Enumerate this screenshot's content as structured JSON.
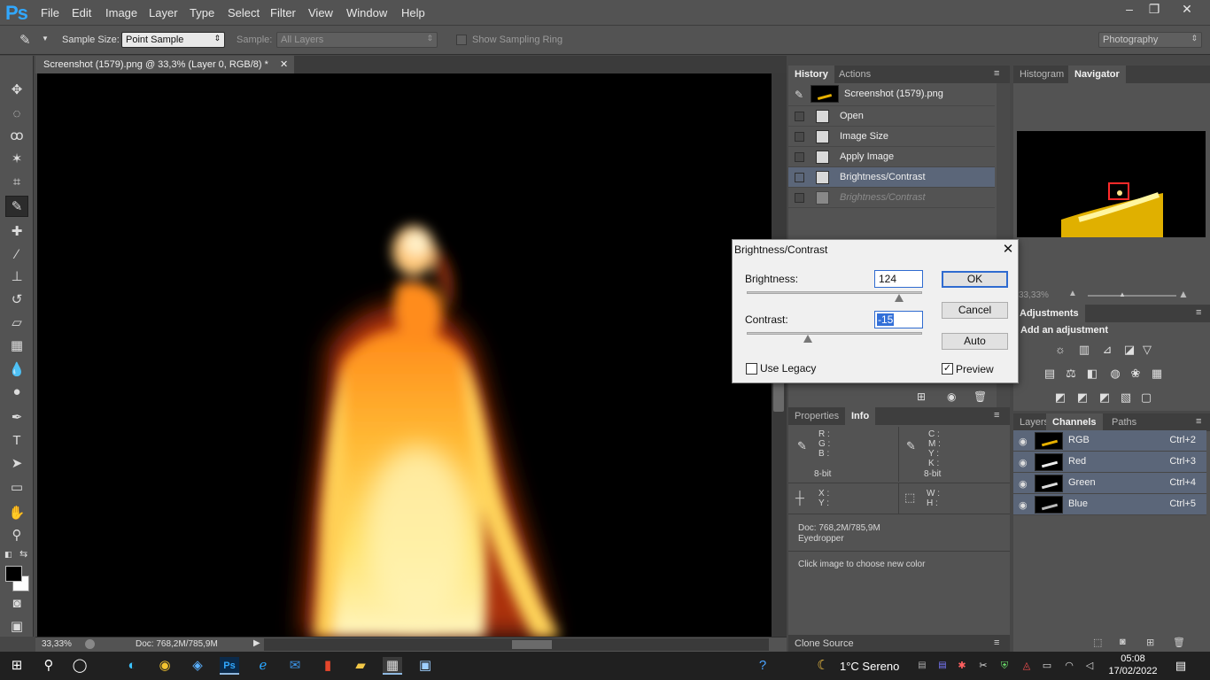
{
  "app": {
    "logo": "Ps"
  },
  "menu": [
    "File",
    "Edit",
    "Image",
    "Layer",
    "Type",
    "Select",
    "Filter",
    "View",
    "Window",
    "Help"
  ],
  "window_controls": {
    "minimize": "–",
    "restore": "❐",
    "close": "✕"
  },
  "options": {
    "sample_size_label": "Sample Size:",
    "sample_size_value": "Point Sample",
    "sample_label": "Sample:",
    "sample_value": "All Layers",
    "show_ring_label": "Show Sampling Ring",
    "workspace": "Photography"
  },
  "document": {
    "tab_title": "Screenshot (1579).png @ 33,3% (Layer 0, RGB/8) *",
    "zoom": "33,33%",
    "doc_size": "Doc: 768,2M/785,9M"
  },
  "history": {
    "tabs": [
      "History",
      "Actions"
    ],
    "snapshot": "Screenshot (1579).png",
    "items": [
      "Open",
      "Image Size",
      "Apply Image",
      "Brightness/Contrast",
      "Brightness/Contrast"
    ],
    "active_index": 3
  },
  "navigator": {
    "tabs": [
      "Histogram",
      "Navigator"
    ],
    "zoom": "33,33%"
  },
  "adjustments": {
    "tab": "Adjustments",
    "title": "Add an adjustment"
  },
  "dialog": {
    "title": "Brightness/Contrast",
    "brightness_label": "Brightness:",
    "brightness_value": "124",
    "contrast_label": "Contrast:",
    "contrast_value": "-15",
    "ok": "OK",
    "cancel": "Cancel",
    "auto": "Auto",
    "use_legacy_label": "Use Legacy",
    "use_legacy_checked": false,
    "preview_label": "Preview",
    "preview_checked": true,
    "brightness_slider_fraction": 0.87,
    "contrast_slider_fraction": 0.35
  },
  "info": {
    "tabs": [
      "Properties",
      "Info"
    ],
    "rgb_labels": [
      "R :",
      "G :",
      "B :"
    ],
    "cmyk_labels": [
      "C :",
      "M :",
      "Y :",
      "K :"
    ],
    "bit_left": "8-bit",
    "bit_right": "8-bit",
    "xy_labels": [
      "X :",
      "Y :"
    ],
    "wh_labels": [
      "W :",
      "H :"
    ],
    "doc_line": "Doc: 768,2M/785,9M",
    "tool_line": "Eyedropper",
    "hint": "Click image to choose new color"
  },
  "clone_source": {
    "tab": "Clone Source"
  },
  "layers_panel": {
    "tabs": [
      "Layers",
      "Channels",
      "Paths"
    ],
    "channels": [
      {
        "name": "RGB",
        "shortcut": "Ctrl+2"
      },
      {
        "name": "Red",
        "shortcut": "Ctrl+3"
      },
      {
        "name": "Green",
        "shortcut": "Ctrl+4"
      },
      {
        "name": "Blue",
        "shortcut": "Ctrl+5"
      }
    ]
  },
  "taskbar": {
    "weather": "1°C  Sereno",
    "time": "05:08",
    "date": "17/02/2022"
  },
  "colors": {
    "accent": "#31a8ff",
    "selection": "#5b6679",
    "dialog_focus": "#2f6bd0"
  }
}
